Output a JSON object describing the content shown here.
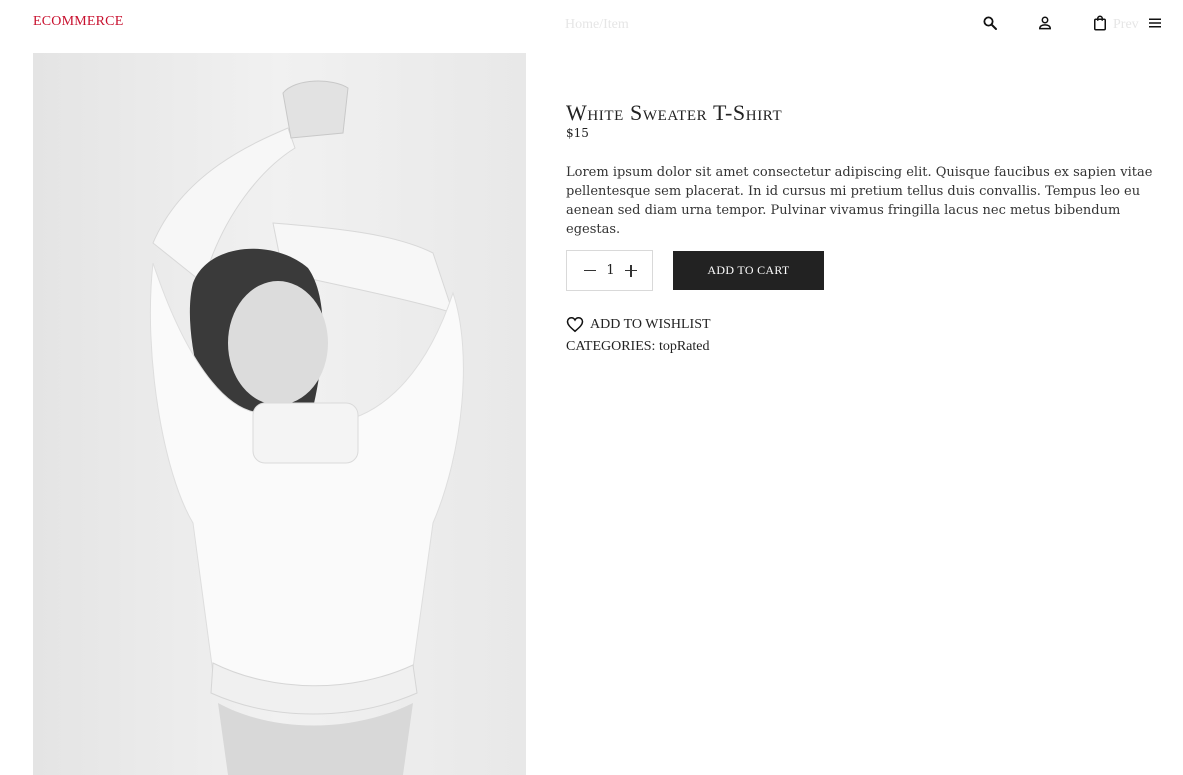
{
  "header": {
    "logo": "ECOMMERCE",
    "breadcrumb": "Home/Item",
    "faded_right": "Prev"
  },
  "product": {
    "title": "White Sweater T-Shirt",
    "price": "$15",
    "description": "Lorem ipsum dolor sit amet consectetur adipiscing elit. Quisque faucibus ex sapien vitae pellentesque sem placerat. In id cursus mi pretium tellus duis convallis. Tempus leo eu aenean sed diam urna tempor. Pulvinar vivamus fringilla lacus nec metus bibendum egestas.",
    "quantity": "1",
    "add_to_cart_label": "ADD TO CART",
    "wishlist_label": "ADD TO WISHLIST",
    "categories_label": "CATEGORIES: ",
    "category": "topRated"
  },
  "icons": {
    "search": "search-icon",
    "account": "user-icon",
    "cart": "shopping-bag-icon",
    "menu": "hamburger-menu-icon",
    "wishlist": "heart-icon"
  },
  "colors": {
    "brand": "#c8102e",
    "button_bg": "#222222",
    "button_text": "#ffffff"
  }
}
